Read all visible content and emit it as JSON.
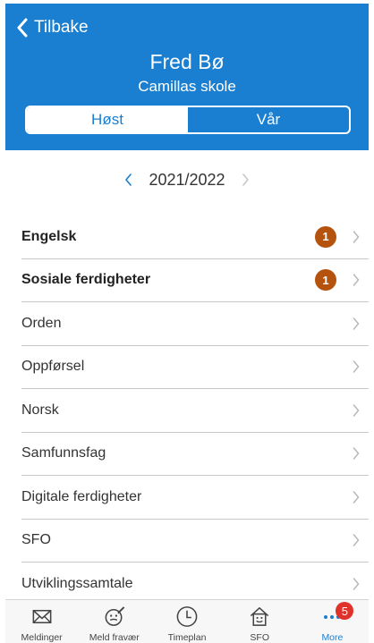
{
  "header": {
    "back_label": "Tilbake",
    "student_name": "Fred Bø",
    "school_name": "Camillas skole",
    "background_color": "#1a7fd1",
    "segments": [
      {
        "label": "Høst",
        "selected": true
      },
      {
        "label": "Vår",
        "selected": false
      }
    ]
  },
  "year_selector": {
    "year": "2021/2022"
  },
  "subjects": [
    {
      "label": "Engelsk",
      "bold": true,
      "badge": "1"
    },
    {
      "label": "Sosiale ferdigheter",
      "bold": true,
      "badge": "1"
    },
    {
      "label": "Orden",
      "bold": false,
      "badge": ""
    },
    {
      "label": "Oppførsel",
      "bold": false,
      "badge": ""
    },
    {
      "label": "Norsk",
      "bold": false,
      "badge": ""
    },
    {
      "label": "Samfunnsfag",
      "bold": false,
      "badge": ""
    },
    {
      "label": "Digitale ferdigheter",
      "bold": false,
      "badge": ""
    },
    {
      "label": "SFO",
      "bold": false,
      "badge": ""
    },
    {
      "label": "Utviklingssamtale",
      "bold": false,
      "badge": ""
    }
  ],
  "tabbar": {
    "tabs": [
      {
        "label": "Meldinger",
        "icon": "envelope-icon"
      },
      {
        "label": "Meld fravær",
        "icon": "absence-icon"
      },
      {
        "label": "Timeplan",
        "icon": "clock-icon"
      },
      {
        "label": "SFO",
        "icon": "house-icon"
      },
      {
        "label": "More",
        "icon": "more-dots-icon",
        "badge": "5",
        "active": true
      }
    ]
  },
  "colors": {
    "accent": "#1a7fd1",
    "badge_subject": "#b5520e",
    "badge_tab": "#e0322b"
  }
}
